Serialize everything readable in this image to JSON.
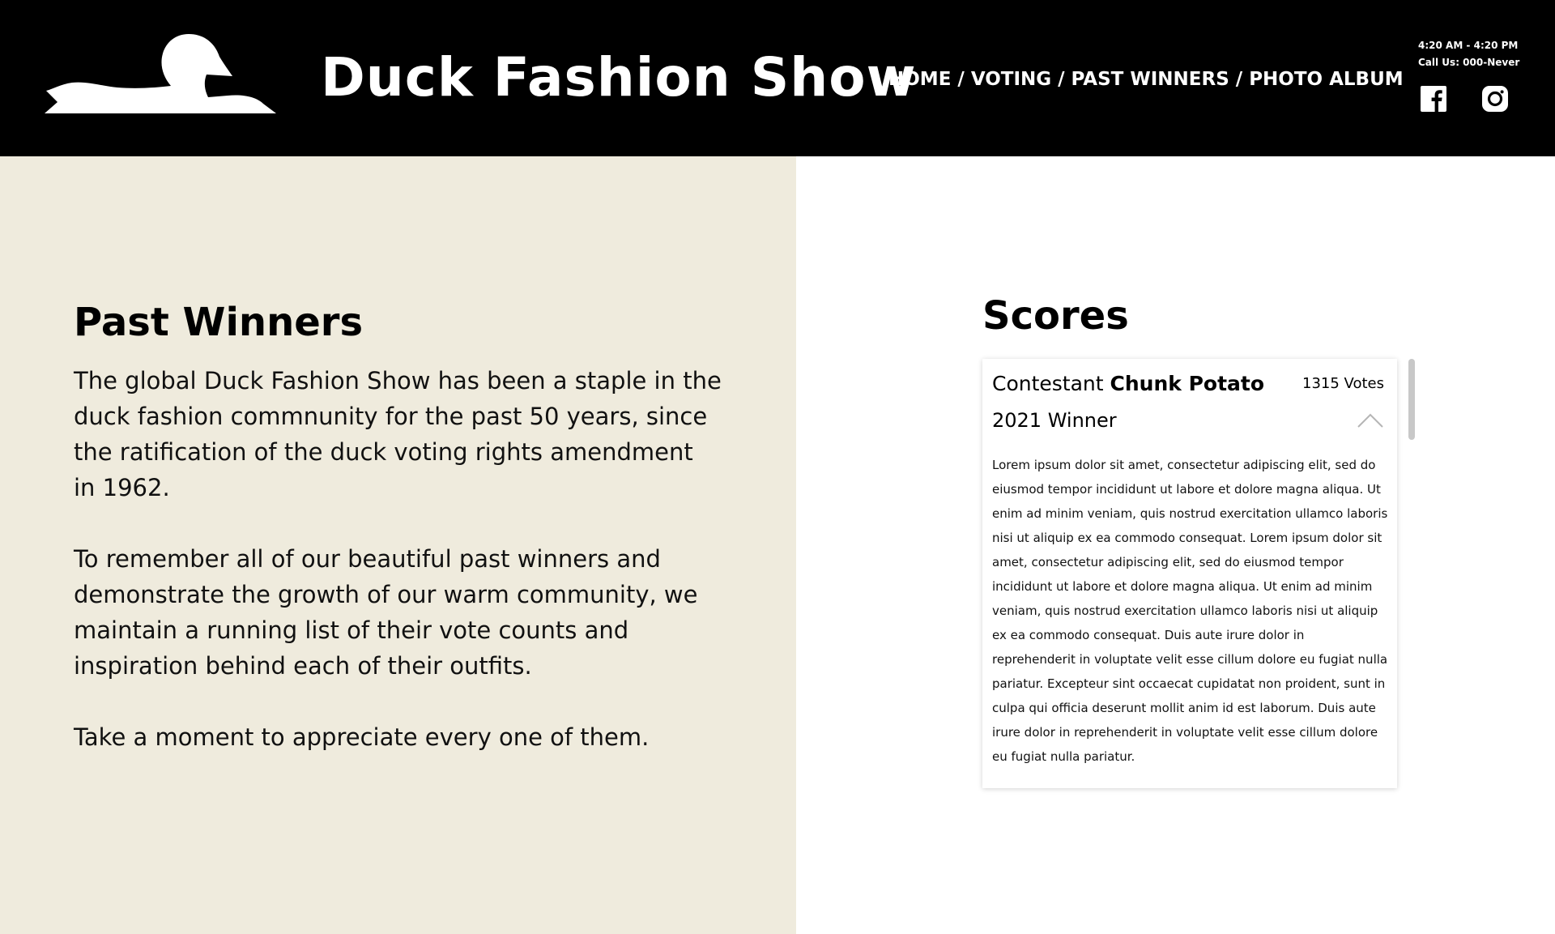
{
  "header": {
    "logo_icon": "duck-silhouette-icon",
    "site_title": "Duck Fashion Show",
    "nav": {
      "home": "HOME",
      "voting": "VOTING",
      "past_winners": "PAST WINNERS",
      "photo_album": "PHOTO ALBUM",
      "separator": "/"
    },
    "hours": "4:20 AM - 4:20 PM",
    "phone": "Call Us: 000-Never",
    "social_icons": [
      "facebook-icon",
      "instagram-icon"
    ]
  },
  "colors": {
    "header_bg": "#000000",
    "left_panel_bg": "#efebdd",
    "right_panel_bg": "#ffffff"
  },
  "past_winners": {
    "title": "Past Winners",
    "paragraphs": [
      "The global Duck Fashion Show has been a staple in the duck fashion commnunity for the past 50 years, since the ratification of the duck voting rights amendment in 1962.",
      "To remember all of our beautiful past winners and demonstrate the growth of our warm community, we maintain a running list of their vote counts and inspiration behind each of their outfits.",
      "Take a moment to appreciate every one of them."
    ]
  },
  "scores": {
    "title": "Scores",
    "entries": [
      {
        "contestant_prefix": "Contestant",
        "contestant_name": "Chunk Potato",
        "votes": "1315 Votes",
        "winner_label": "2021 Winner",
        "expanded": true,
        "description": "Lorem ipsum dolor sit amet, consectetur adipiscing elit, sed do eiusmod tempor incididunt ut labore et dolore magna aliqua. Ut enim ad minim veniam, quis nostrud exercitation ullamco laboris nisi ut aliquip ex ea commodo consequat. Lorem ipsum dolor sit amet, consectetur adipiscing elit, sed do eiusmod tempor incididunt ut labore et dolore magna aliqua. Ut enim ad minim veniam, quis nostrud exercitation ullamco laboris nisi ut aliquip ex ea commodo consequat. Duis aute irure dolor in reprehenderit in voluptate velit esse cillum dolore eu fugiat nulla pariatur. Excepteur sint occaecat cupidatat non proident, sunt in culpa qui officia deserunt mollit anim id est laborum. Duis aute irure dolor in reprehenderit in voluptate velit esse cillum dolore eu fugiat nulla pariatur."
      }
    ]
  }
}
